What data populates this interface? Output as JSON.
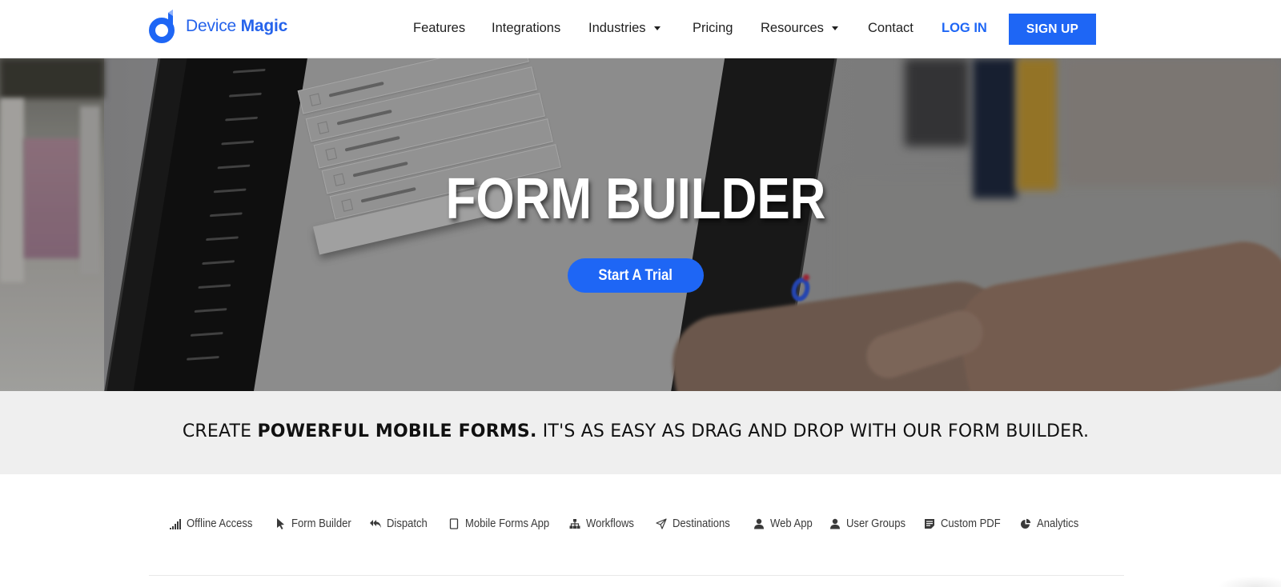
{
  "header": {
    "logo": {
      "text_light": "Device",
      "text_bold": "Magic",
      "brand_color": "#1E66F5"
    },
    "nav": [
      {
        "label": "Features",
        "has_dropdown": false
      },
      {
        "label": "Integrations",
        "has_dropdown": false
      },
      {
        "label": "Industries",
        "has_dropdown": true
      },
      {
        "label": "Pricing",
        "has_dropdown": false
      },
      {
        "label": "Resources",
        "has_dropdown": true
      },
      {
        "label": "Contact",
        "has_dropdown": false
      }
    ],
    "login_label": "LOG IN",
    "signup_label": "SIGN UP"
  },
  "hero": {
    "title": "FORM BUILDER",
    "cta_label": "Start A Trial",
    "cta_color": "#1E66F5"
  },
  "tagline": {
    "prefix": "CREATE ",
    "bold": "POWERFUL MOBILE FORMS.",
    "suffix": " IT'S AS EASY AS DRAG AND DROP WITH OUR FORM BUILDER."
  },
  "features": [
    {
      "label": "Offline Access",
      "icon": "signal-bars-icon"
    },
    {
      "label": "Form Builder",
      "icon": "cursor-pointer-icon"
    },
    {
      "label": "Dispatch",
      "icon": "reply-all-icon"
    },
    {
      "label": "Mobile Forms App",
      "icon": "tablet-icon"
    },
    {
      "label": "Workflows",
      "icon": "sitemap-icon"
    },
    {
      "label": "Destinations",
      "icon": "paper-plane-icon"
    },
    {
      "label": "Web App",
      "icon": "user-icon"
    },
    {
      "label": "User Groups",
      "icon": "user-icon"
    },
    {
      "label": "Custom PDF",
      "icon": "document-list-icon"
    },
    {
      "label": "Analytics",
      "icon": "pie-chart-icon"
    }
  ]
}
